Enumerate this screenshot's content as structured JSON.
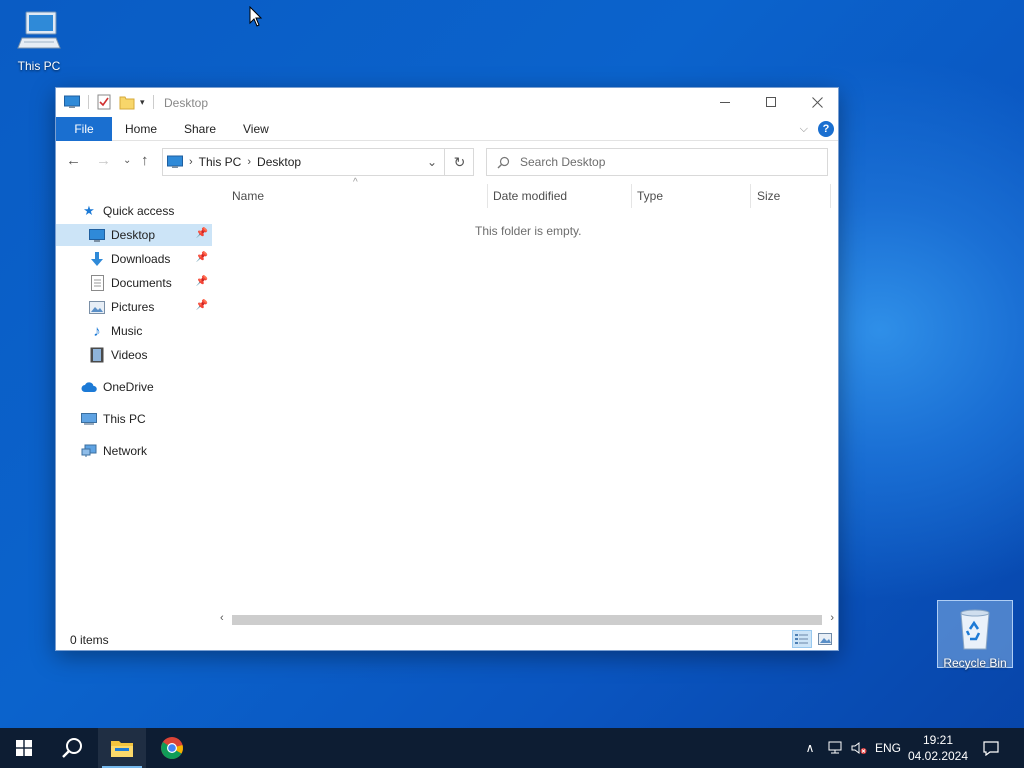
{
  "desktop": {
    "icons": [
      {
        "label": "This PC"
      },
      {
        "label": "Recycle Bin"
      }
    ]
  },
  "window": {
    "title": "Desktop",
    "ribbon_tabs": [
      "File",
      "Home",
      "Share",
      "View"
    ],
    "address": {
      "crumbs": [
        "This PC",
        "Desktop"
      ]
    },
    "search": {
      "placeholder": "Search Desktop",
      "value": ""
    },
    "nav": {
      "quick_access": "Quick access",
      "items": [
        {
          "label": "Desktop",
          "icon": "desktop-icon",
          "pinned": true,
          "selected": true
        },
        {
          "label": "Downloads",
          "icon": "downloads-icon",
          "pinned": true
        },
        {
          "label": "Documents",
          "icon": "documents-icon",
          "pinned": true
        },
        {
          "label": "Pictures",
          "icon": "pictures-icon",
          "pinned": true
        },
        {
          "label": "Music",
          "icon": "music-icon",
          "pinned": false
        },
        {
          "label": "Videos",
          "icon": "videos-icon",
          "pinned": false
        }
      ],
      "onedrive": "OneDrive",
      "thispc": "This PC",
      "network": "Network"
    },
    "columns": [
      "Name",
      "Date modified",
      "Type",
      "Size"
    ],
    "empty_message": "This folder is empty.",
    "status": "0 items"
  },
  "taskbar": {
    "lang": "ENG",
    "time": "19:21",
    "date": "04.02.2024"
  },
  "colors": {
    "accent": "#1a6fd0",
    "selection": "#cce4f7",
    "taskbar": "#0d1d33"
  }
}
